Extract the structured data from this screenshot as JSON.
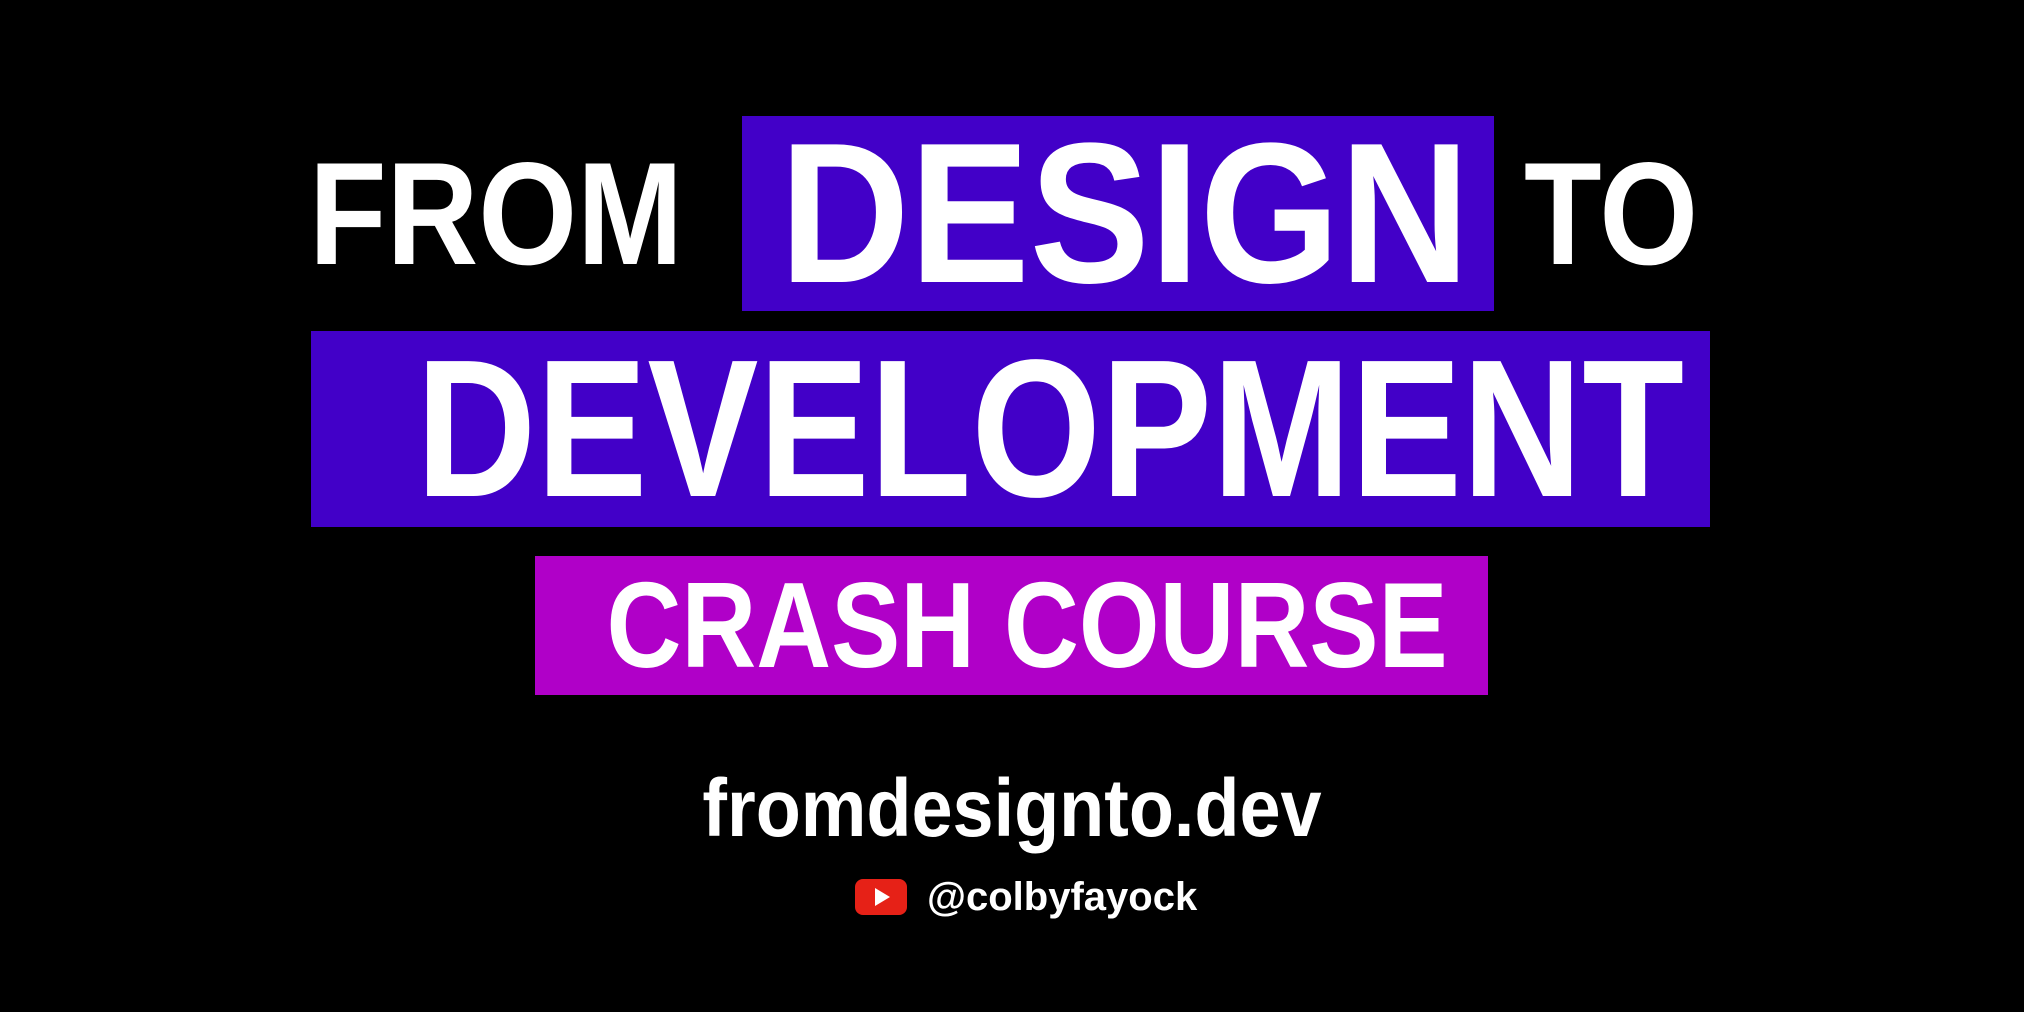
{
  "title": {
    "line1_prefix": "FROM",
    "line1_highlight": "DESIGN",
    "line1_suffix": "TO",
    "line2": "DEVELOPMENT",
    "line3": "CRASH COURSE"
  },
  "footer": {
    "website": "fromdesignto.dev",
    "social_icon": "youtube-icon",
    "handle": "@colbyfayock"
  },
  "colors": {
    "background": "#000000",
    "primary_highlight": "#4200c8",
    "secondary_highlight": "#b000c8",
    "text": "#ffffff",
    "youtube_red": "#e62117"
  }
}
